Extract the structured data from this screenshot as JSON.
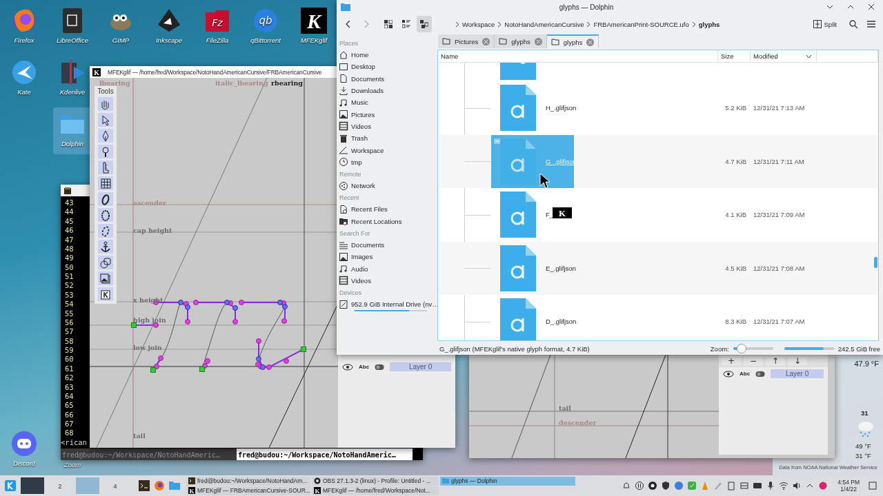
{
  "desktop": {
    "icons": [
      {
        "label": "Firefox",
        "kind": "browser",
        "selected": false
      },
      {
        "label": "LibreOffice",
        "kind": "office",
        "selected": false
      },
      {
        "label": "GIMP",
        "kind": "paint",
        "selected": false
      },
      {
        "label": "Inkscape",
        "kind": "vector",
        "selected": false
      },
      {
        "label": "FileZilla",
        "kind": "ftp",
        "logo": "Fz",
        "selected": false
      },
      {
        "label": "qBittorrent",
        "kind": "torrent",
        "logo": "qb",
        "selected": false
      },
      {
        "label": "MFEKglif",
        "kind": "font",
        "logo": "K",
        "selected": false
      },
      {
        "label": "Kate",
        "kind": "editor",
        "selected": false
      },
      {
        "label": "Kdenlive",
        "kind": "video",
        "selected": false
      },
      {
        "label": "Dolphin",
        "kind": "folder",
        "selected": true
      },
      {
        "label": "Discord",
        "kind": "chat",
        "selected": false
      },
      {
        "label": "Zoom",
        "selected": false
      }
    ]
  },
  "weather": {
    "current": "47.9 °F",
    "day": "31",
    "high": "49 °F",
    "low": "31 °F",
    "credit": "Data from NOAA National Weather Service"
  },
  "glyph_editor_2": {
    "guides": [
      {
        "label": "tail",
        "kind": "guide"
      },
      {
        "label": "descender",
        "kind": "metric"
      }
    ],
    "layer_buttons": [
      "+",
      "−",
      "↑",
      "↓"
    ],
    "layers": [
      {
        "abc": "Abc",
        "label": "Layer 0",
        "selected": true
      }
    ]
  },
  "terminal": {
    "line_numbers": [
      "43",
      "44",
      "45",
      "46",
      "47",
      "48",
      "49",
      "50",
      "51",
      "52",
      "53",
      "54",
      "55",
      "56",
      "57",
      "58",
      "59",
      "60",
      "61",
      "62",
      "63",
      "64",
      "65",
      "66",
      "67",
      "68"
    ],
    "last_line": "<rican",
    "tabs": [
      {
        "label": "fred@budou:~/Workspace/NotoHandAmeric…",
        "selected": false
      },
      {
        "label": "fred@budou:~/Workspace/NotoHandAmeric…",
        "selected": true
      }
    ]
  },
  "glyph_editor": {
    "logo": "K",
    "title": "MFEKglif — /home/fred/Workspace/NotoHandAmericanCursive/FRBAmericanCursive",
    "tools_title": "Tools",
    "vertical_guides": [
      {
        "label": "lbearing",
        "kind": "metric"
      },
      {
        "label": "italic_lbearing",
        "kind": "metric"
      },
      {
        "label": "rbearing",
        "kind": "active"
      }
    ],
    "guides": [
      {
        "label": "ascender",
        "kind": "metric"
      },
      {
        "label": "cap height",
        "kind": "guide"
      },
      {
        "label": "x height",
        "kind": "guide"
      },
      {
        "label": "high join",
        "kind": "guide"
      },
      {
        "label": "low join",
        "kind": "guide"
      },
      {
        "label": "tail",
        "kind": "guide"
      }
    ],
    "layers": [
      {
        "abc": "Abc",
        "label": "Layer 0",
        "selected": true
      }
    ]
  },
  "file_manager": {
    "title": "glyphs — Dolphin",
    "breadcrumb": [
      {
        "label": "Workspace",
        "current": false
      },
      {
        "label": "NotoHandAmericanCursive",
        "current": false
      },
      {
        "label": "FRBAmericanPrint-SOURCE.ufo",
        "current": false
      },
      {
        "label": "glyphs",
        "current": true
      }
    ],
    "split_label": "Split",
    "sidebar": [
      {
        "title": "Places",
        "items": [
          {
            "label": "Home",
            "kind": "home"
          },
          {
            "label": "Desktop",
            "kind": "desktop"
          },
          {
            "label": "Documents",
            "kind": "doc"
          },
          {
            "label": "Downloads",
            "kind": "download"
          },
          {
            "label": "Music",
            "kind": "music"
          },
          {
            "label": "Pictures",
            "kind": "picture"
          },
          {
            "label": "Videos",
            "kind": "video"
          },
          {
            "label": "Trash",
            "kind": "trash"
          },
          {
            "label": "Workspace",
            "kind": "workspace"
          },
          {
            "label": "tmp",
            "kind": "clock"
          }
        ]
      },
      {
        "title": "Remote",
        "items": [
          {
            "label": "Network",
            "kind": "network"
          }
        ]
      },
      {
        "title": "Recent",
        "items": [
          {
            "label": "Recent Files",
            "kind": "recentfile"
          },
          {
            "label": "Recent Locations",
            "kind": "recentfolder"
          }
        ]
      },
      {
        "title": "Search For",
        "items": [
          {
            "label": "Documents",
            "kind": "lines"
          },
          {
            "label": "Images",
            "kind": "picture"
          },
          {
            "label": "Audio",
            "kind": "music"
          },
          {
            "label": "Videos",
            "kind": "video"
          }
        ]
      },
      {
        "title": "Devices",
        "items": [
          {
            "label": "952.9 GiB Internal Drive (nv…",
            "kind": "drive",
            "level": 0.75
          }
        ]
      }
    ],
    "tabs": [
      {
        "label": "Pictures",
        "selected": false
      },
      {
        "label": "glyphs",
        "selected": false
      },
      {
        "label": "glyphs",
        "selected": true
      }
    ],
    "columns": [
      "Name",
      "Size",
      "Modified"
    ],
    "rows": [
      {
        "name": "H_.glifjson",
        "size": "5.2 KiB",
        "modified": "12/31/21 7:13 AM",
        "selected": false
      },
      {
        "name": "G_.glifjson",
        "size": "4.7 KiB",
        "modified": "12/31/21 7:11 AM",
        "selected": true
      },
      {
        "name": "F_",
        "size": "4.1 KiB",
        "modified": "12/31/21 7:09 AM",
        "selected": false
      },
      {
        "name": "E_.glifjson",
        "size": "4.5 KiB",
        "modified": "12/31/21 7:08 AM",
        "selected": false
      },
      {
        "name": "D_.glifjson",
        "size": "8.3 KiB",
        "modified": "12/31/21 7:07 AM",
        "selected": false
      }
    ],
    "drag_logo": "K",
    "status": "G_.glifjson (MFEKglif's native glyph format, 4.7 KiB)",
    "zoom_label": "Zoom:",
    "zoom": {
      "level": 0.2
    },
    "free_space": "242.5 GiB free",
    "disk": {
      "level": 0.8
    }
  },
  "taskbar": {
    "pager": [
      {
        "selected": true
      },
      {
        "label": "2",
        "selected": false
      },
      {
        "selected": false
      },
      {
        "label": "4",
        "selected": false
      }
    ],
    "tasks": [
      {
        "label": "fred@budou:~/Workspace/NotoHandAm...",
        "kind": "terminal",
        "selected": false
      },
      {
        "label": "OBS 27.1.3-2 (linux) - Profile: Untitled - ...",
        "kind": "obs",
        "selected": false
      },
      {
        "label": "glyphs — Dolphin",
        "kind": "folder",
        "selected": true
      },
      {
        "label": "MFEKglif — FRBAmericanCursive-SOUR...",
        "kind": "logo",
        "logo": "K",
        "selected": false
      },
      {
        "label": "MFEKglif — /home/fred/Workspace/Not...",
        "kind": "logo",
        "logo": "K",
        "selected": false
      }
    ],
    "time": "4:54 PM",
    "date": "1/4/22"
  }
}
